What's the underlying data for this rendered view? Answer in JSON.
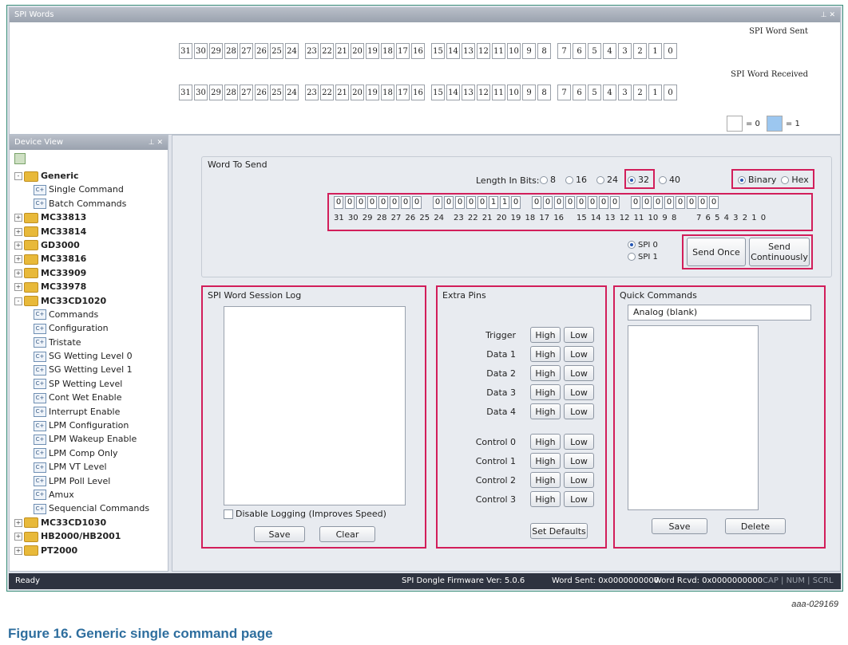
{
  "spi_words": {
    "title": "SPI Words",
    "controls": "⊥ ✕",
    "sent_label": "SPI Word Sent",
    "received_label": "SPI Word Received",
    "sent_bits": [
      "31",
      "30",
      "29",
      "28",
      "27",
      "26",
      "25",
      "24",
      "23",
      "22",
      "21",
      "20",
      "19",
      "18",
      "17",
      "16",
      "15",
      "14",
      "13",
      "12",
      "11",
      "10",
      "9",
      "8",
      "7",
      "6",
      "5",
      "4",
      "3",
      "2",
      "1",
      "0"
    ],
    "received_bits": [
      "31",
      "30",
      "29",
      "28",
      "27",
      "26",
      "25",
      "24",
      "23",
      "22",
      "21",
      "20",
      "19",
      "18",
      "17",
      "16",
      "15",
      "14",
      "13",
      "12",
      "11",
      "10",
      "9",
      "8",
      "7",
      "6",
      "5",
      "4",
      "3",
      "2",
      "1",
      "0"
    ],
    "legend_zero": "= 0",
    "legend_one": "= 1",
    "legend_one_color": "#9cc7f0"
  },
  "device_view": {
    "title": "Device View",
    "controls": "⊥ ✕",
    "items": [
      {
        "label": "Generic",
        "level": 0,
        "type": "folder",
        "expand": "-",
        "bold": true
      },
      {
        "label": "Single Command",
        "level": 1,
        "type": "leaf"
      },
      {
        "label": "Batch Commands",
        "level": 1,
        "type": "leaf"
      },
      {
        "label": "MC33813",
        "level": 0,
        "type": "folder",
        "expand": "+",
        "bold": true
      },
      {
        "label": "MC33814",
        "level": 0,
        "type": "folder",
        "expand": "+",
        "bold": true
      },
      {
        "label": "GD3000",
        "level": 0,
        "type": "folder",
        "expand": "+",
        "bold": true
      },
      {
        "label": "MC33816",
        "level": 0,
        "type": "folder",
        "expand": "+",
        "bold": true
      },
      {
        "label": "MC33909",
        "level": 0,
        "type": "folder",
        "expand": "+",
        "bold": true
      },
      {
        "label": "MC33978",
        "level": 0,
        "type": "folder",
        "expand": "+",
        "bold": true
      },
      {
        "label": "MC33CD1020",
        "level": 0,
        "type": "folder",
        "expand": "-",
        "bold": true
      },
      {
        "label": "Commands",
        "level": 1,
        "type": "leaf"
      },
      {
        "label": "Configuration",
        "level": 1,
        "type": "leaf"
      },
      {
        "label": "Tristate",
        "level": 1,
        "type": "leaf"
      },
      {
        "label": "SG Wetting Level 0",
        "level": 1,
        "type": "leaf"
      },
      {
        "label": "SG Wetting Level 1",
        "level": 1,
        "type": "leaf"
      },
      {
        "label": "SP Wetting Level",
        "level": 1,
        "type": "leaf"
      },
      {
        "label": "Cont Wet Enable",
        "level": 1,
        "type": "leaf"
      },
      {
        "label": "Interrupt Enable",
        "level": 1,
        "type": "leaf"
      },
      {
        "label": "LPM Configuration",
        "level": 1,
        "type": "leaf"
      },
      {
        "label": "LPM Wakeup Enable",
        "level": 1,
        "type": "leaf"
      },
      {
        "label": "LPM Comp Only",
        "level": 1,
        "type": "leaf"
      },
      {
        "label": "LPM VT Level",
        "level": 1,
        "type": "leaf"
      },
      {
        "label": "LPM Poll Level",
        "level": 1,
        "type": "leaf"
      },
      {
        "label": "Amux",
        "level": 1,
        "type": "leaf"
      },
      {
        "label": "Sequencial Commands",
        "level": 1,
        "type": "leaf"
      },
      {
        "label": "MC33CD1030",
        "level": 0,
        "type": "folder",
        "expand": "+",
        "bold": true
      },
      {
        "label": "HB2000/HB2001",
        "level": 0,
        "type": "folder",
        "expand": "+",
        "bold": true
      },
      {
        "label": "PT2000",
        "level": 0,
        "type": "folder",
        "expand": "+",
        "bold": true
      }
    ]
  },
  "word_to_send": {
    "title": "Word To Send",
    "length_label": "Length In Bits:",
    "length_options": [
      "8",
      "16",
      "24",
      "32",
      "40"
    ],
    "length_selected": "32",
    "format_options": [
      "Binary",
      "Hex"
    ],
    "format_selected": "Binary",
    "bits": [
      "0",
      "0",
      "0",
      "0",
      "0",
      "0",
      "0",
      "0",
      "0",
      "0",
      "0",
      "0",
      "0",
      "1",
      "1",
      "0",
      "0",
      "0",
      "0",
      "0",
      "0",
      "0",
      "0",
      "0",
      "0",
      "0",
      "0",
      "0",
      "0",
      "0",
      "0",
      "0"
    ],
    "bit_labels": [
      "31 30 29 28 27 26 25 24",
      "23 22 21 20 19 18 17 16",
      "15 14 13 12 11 10  9  8",
      "7  6  5  4  3  2  1  0"
    ],
    "spi_options": [
      "SPI 0",
      "SPI 1"
    ],
    "spi_selected": "SPI 0",
    "send_once": "Send Once",
    "send_continuously": "Send Continuously"
  },
  "session_log": {
    "title": "SPI Word Session Log",
    "disable_logging": "Disable Logging (Improves Speed)",
    "save": "Save",
    "clear": "Clear"
  },
  "extra_pins": {
    "title": "Extra Pins",
    "pins": [
      "Trigger",
      "Data 1",
      "Data 2",
      "Data 3",
      "Data 4",
      "Control 0",
      "Control 1",
      "Control 2",
      "Control 3"
    ],
    "high": "High",
    "low": "Low",
    "set_defaults": "Set Defaults"
  },
  "quick_commands": {
    "title": "Quick Commands",
    "field_value": "Analog (blank)",
    "save": "Save",
    "delete": "Delete"
  },
  "status_bar": {
    "ready": "Ready",
    "firmware": "SPI Dongle Firmware Ver: 5.0.6",
    "word_sent": "Word Sent: 0x0000000000",
    "word_rcvd": "Word Rcvd: 0x0000000000",
    "indicators": "CAP | NUM | SCRL"
  },
  "figure": {
    "id": "aaa-029169",
    "caption": "Figure 16. Generic single command page"
  }
}
